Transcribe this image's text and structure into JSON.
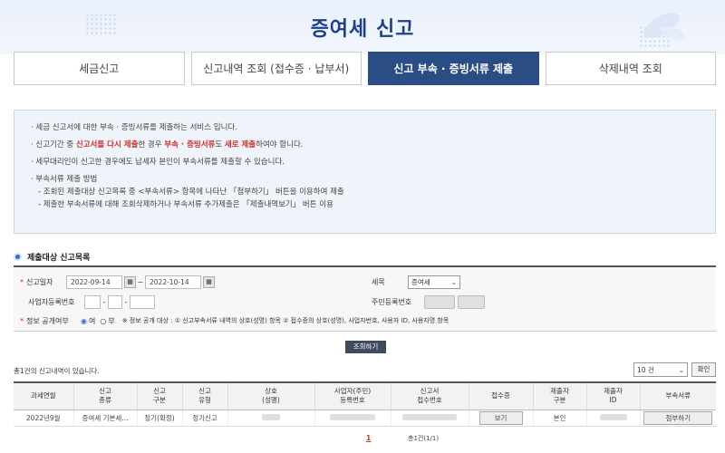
{
  "page": {
    "title": "증여세 신고"
  },
  "tabs": [
    {
      "label": "세금신고",
      "active": false
    },
    {
      "label": "신고내역 조회 (접수증 · 납부서)",
      "active": false
    },
    {
      "label": "신고 부속 · 증빙서류 제출",
      "active": true
    },
    {
      "label": "삭제내역 조회",
      "active": false
    }
  ],
  "notice": {
    "line1": "· 세금 신고서에 대한 부속 · 증빙서류를 제출하는 서비스 입니다.",
    "line2_a": "· 신고기간 중 ",
    "line2_b": "신고서를 다시 제출",
    "line2_c": "한 경우 ",
    "line2_d": "부속 · 증빙서류",
    "line2_e": "도 ",
    "line2_f": "새로 제출",
    "line2_g": "하여야 합니다.",
    "line3": "· 세무대리인이 신고한 경우에도 납세자 본인이 부속서류를 제출할 수 있습니다.",
    "line4": "· 부속서류 제출 방법",
    "line5": "- 조회된 제출대상 신고목록 중 <부속서류> 항목에 나타난 「첨부하기」 버튼을 이용하여 제출",
    "line6": "- 제출한 부속서류에 대해 조회삭제하거나 부속서류 추가제출은 「제출내역보기」 버튼 이용"
  },
  "section": {
    "title": "제출대상 신고목록"
  },
  "form": {
    "report_date_label": "신고일자",
    "date_from": "2022-09-14",
    "date_to": "2022-10-14",
    "date_sep": "~",
    "calendar_icon": "calendar-icon",
    "tax_item_label": "세목",
    "tax_item_value": "증여세",
    "bizno_label": "사업자등록번호",
    "bizno_sep": "-",
    "resno_label": "주민등록번호",
    "disclose_label": "정보 공개여부",
    "disclose_yes": "여",
    "disclose_no": "부",
    "disclose_note": "※ 정보 공개 대상 : ① 신고부속서류 내역의 상호(성명) 항목 ② 접수증의 상호(성명), 사업자번호, 사용자 ID, 사용자명 항목"
  },
  "search_button": "조회하기",
  "result": {
    "count_text": "총1건의 신고내역이 있습니다.",
    "per_page": "10 건",
    "confirm_button": "확인"
  },
  "table": {
    "headers": [
      "과세연월",
      "신고\n종류",
      "신고\n구분",
      "신고\n유형",
      "상호\n(성명)",
      "사업자(주민)\n등록번호",
      "신고서\n접수번호",
      "접수증",
      "제출자\n구분",
      "제출자\nID",
      "부속서류"
    ],
    "rows": [
      [
        "2022년9월",
        "증여세 기본세...",
        "정기(확정)",
        "정기신고",
        "",
        "",
        "",
        "보기",
        "본인",
        "",
        "첨부하기"
      ]
    ]
  },
  "pagination": {
    "current": "1",
    "info": "총1건(1/1)"
  },
  "colors": {
    "accent": "#2b4d86",
    "title": "#1e3f8a",
    "emphasis": "#d42b2b"
  }
}
